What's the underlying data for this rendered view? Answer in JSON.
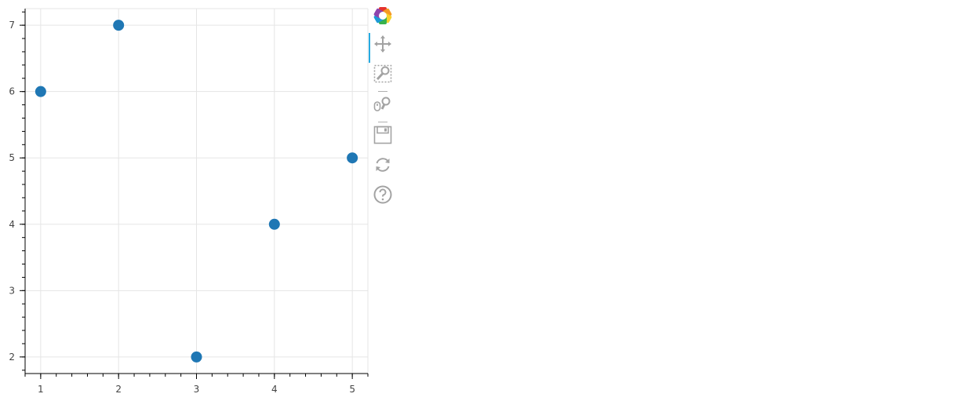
{
  "chart_data": {
    "type": "scatter",
    "x": [
      1,
      2,
      3,
      4,
      5
    ],
    "y": [
      6,
      7,
      2,
      4,
      5
    ],
    "xlim": [
      0.8,
      5.2
    ],
    "ylim": [
      1.75,
      7.25
    ],
    "xticks": [
      1,
      2,
      3,
      4,
      5
    ],
    "yticks": [
      2,
      3,
      4,
      5,
      6,
      7
    ],
    "x_minor_step": 0.2,
    "y_minor_step": 0.2,
    "grid": true,
    "title": "",
    "xlabel": "",
    "ylabel": "",
    "colors": {
      "marker": "#1f77b4",
      "grid": "#e5e5e5",
      "axis": "#000000"
    }
  },
  "toolbar": {
    "active_color": "#26aae1",
    "icon_color": "#a3a3a3",
    "tools": [
      {
        "name": "bokeh-logo-icon",
        "active": false
      },
      {
        "name": "pan-icon",
        "active": true
      },
      {
        "name": "box-zoom-icon",
        "active": false
      },
      {
        "name": "wheel-zoom-icon",
        "active": false
      },
      {
        "name": "save-icon",
        "active": false
      },
      {
        "name": "reset-icon",
        "active": false
      },
      {
        "name": "help-icon",
        "active": false
      }
    ]
  }
}
